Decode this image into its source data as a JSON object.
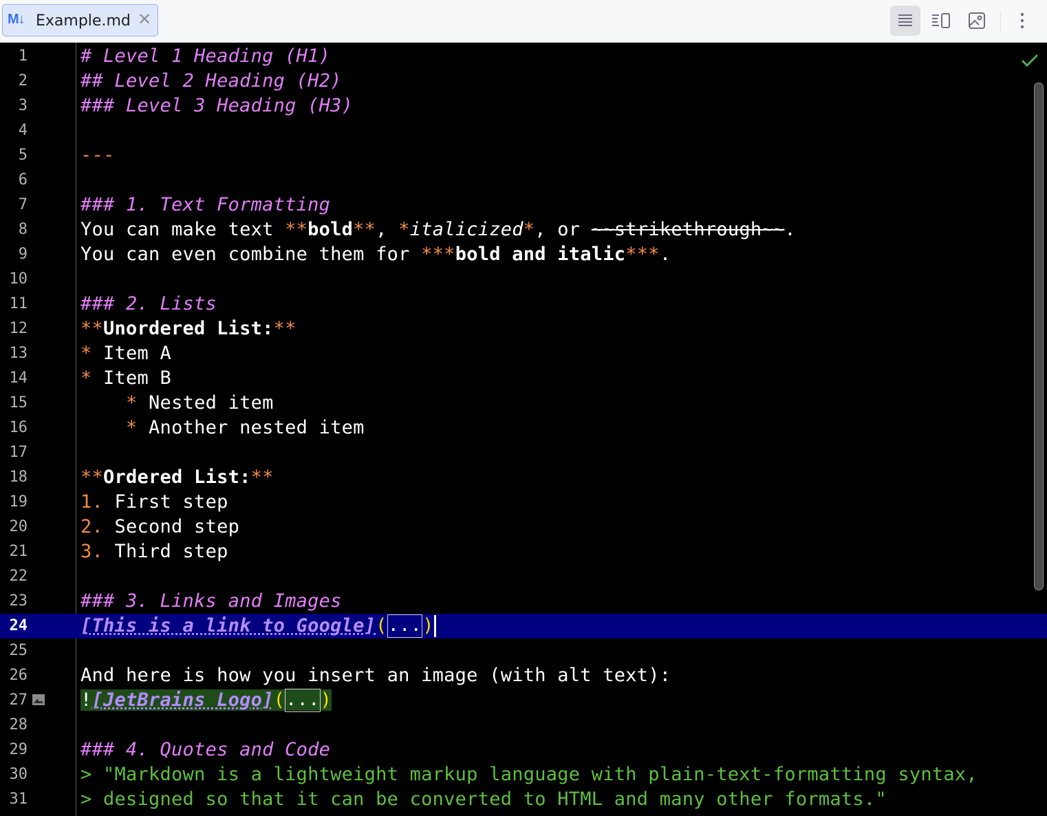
{
  "tab": {
    "icon": "M↓",
    "filename": "Example.md",
    "close": "✕"
  },
  "toolbar": {
    "buttons": [
      {
        "name": "editor-only-icon",
        "active": true
      },
      {
        "name": "split-view-icon",
        "active": false
      },
      {
        "name": "preview-only-icon",
        "active": false
      },
      {
        "name": "more-options-icon",
        "active": false
      }
    ]
  },
  "editor": {
    "status_icon": "checkmark-icon",
    "current_line": 24,
    "lines": [
      {
        "n": "1",
        "segs": [
          [
            "h",
            "# Level 1 Heading (H1)"
          ]
        ]
      },
      {
        "n": "2",
        "segs": [
          [
            "h",
            "## Level 2 Heading (H2)"
          ]
        ]
      },
      {
        "n": "3",
        "segs": [
          [
            "h",
            "### Level 3 Heading (H3)"
          ]
        ]
      },
      {
        "n": "4",
        "segs": []
      },
      {
        "n": "5",
        "segs": [
          [
            "mk",
            "---"
          ]
        ]
      },
      {
        "n": "6",
        "segs": []
      },
      {
        "n": "7",
        "segs": [
          [
            "h",
            "### 1. Text Formatting"
          ]
        ]
      },
      {
        "n": "8",
        "segs": [
          [
            "",
            "You can make text "
          ],
          [
            "mk",
            "**"
          ],
          [
            "b",
            "bold"
          ],
          [
            "mk",
            "**"
          ],
          [
            "",
            ", "
          ],
          [
            "mk i",
            "*"
          ],
          [
            "i",
            "italicized"
          ],
          [
            "mk i",
            "*"
          ],
          [
            "",
            ", or "
          ],
          [
            "st",
            "~~strikethrough~~"
          ],
          [
            "",
            "."
          ]
        ]
      },
      {
        "n": "9",
        "segs": [
          [
            "",
            "You can even combine them for "
          ],
          [
            "mk",
            "***"
          ],
          [
            "b",
            "bold and italic"
          ],
          [
            "mk",
            "***"
          ],
          [
            "",
            "."
          ]
        ]
      },
      {
        "n": "10",
        "segs": []
      },
      {
        "n": "11",
        "segs": [
          [
            "h",
            "### 2. Lists"
          ]
        ]
      },
      {
        "n": "12",
        "segs": [
          [
            "mk",
            "**"
          ],
          [
            "b",
            "Unordered List:"
          ],
          [
            "mk",
            "**"
          ]
        ]
      },
      {
        "n": "13",
        "segs": [
          [
            "mk",
            "*"
          ],
          [
            "",
            " Item A"
          ]
        ]
      },
      {
        "n": "14",
        "segs": [
          [
            "mk",
            "*"
          ],
          [
            "",
            " Item B"
          ]
        ]
      },
      {
        "n": "15",
        "segs": [
          [
            "",
            "    "
          ],
          [
            "mk",
            "*"
          ],
          [
            "",
            " Nested item"
          ]
        ]
      },
      {
        "n": "16",
        "segs": [
          [
            "",
            "    "
          ],
          [
            "mk",
            "*"
          ],
          [
            "",
            " Another nested item"
          ]
        ]
      },
      {
        "n": "17",
        "segs": []
      },
      {
        "n": "18",
        "segs": [
          [
            "mk",
            "**"
          ],
          [
            "b",
            "Ordered List:"
          ],
          [
            "mk",
            "**"
          ]
        ]
      },
      {
        "n": "19",
        "segs": [
          [
            "mk",
            "1."
          ],
          [
            "",
            " First step"
          ]
        ]
      },
      {
        "n": "20",
        "segs": [
          [
            "mk",
            "2."
          ],
          [
            "",
            " Second step"
          ]
        ]
      },
      {
        "n": "21",
        "segs": [
          [
            "mk",
            "3."
          ],
          [
            "",
            " Third step"
          ]
        ]
      },
      {
        "n": "22",
        "segs": []
      },
      {
        "n": "23",
        "segs": [
          [
            "h",
            "### 3. Links and Images"
          ]
        ]
      },
      {
        "n": "24",
        "segs": [
          [
            "lnk",
            "[This is a link to Google]"
          ],
          [
            "par",
            "("
          ],
          [
            "fold",
            "..."
          ],
          [
            "par",
            ")"
          ],
          [
            "caret",
            ""
          ]
        ]
      },
      {
        "n": "25",
        "segs": []
      },
      {
        "n": "26",
        "segs": [
          [
            "",
            "And here is how you insert an image (with alt text):"
          ]
        ]
      },
      {
        "n": "27",
        "segs": [
          [
            "",
            "!"
          ],
          [
            "lnk",
            "[JetBrains Logo]"
          ],
          [
            "par",
            "("
          ],
          [
            "fold",
            "..."
          ],
          [
            "par",
            ")"
          ]
        ],
        "gutter_icon": "image-icon",
        "highlight": "image"
      },
      {
        "n": "28",
        "segs": []
      },
      {
        "n": "29",
        "segs": [
          [
            "h",
            "### 4. Quotes and Code"
          ]
        ]
      },
      {
        "n": "30",
        "segs": [
          [
            "q",
            "> \"Markdown is a lightweight markup language with plain-text-formatting syntax,"
          ]
        ]
      },
      {
        "n": "31",
        "segs": [
          [
            "q",
            "> designed so that it can be converted to HTML and many other formats.\""
          ]
        ]
      }
    ]
  }
}
